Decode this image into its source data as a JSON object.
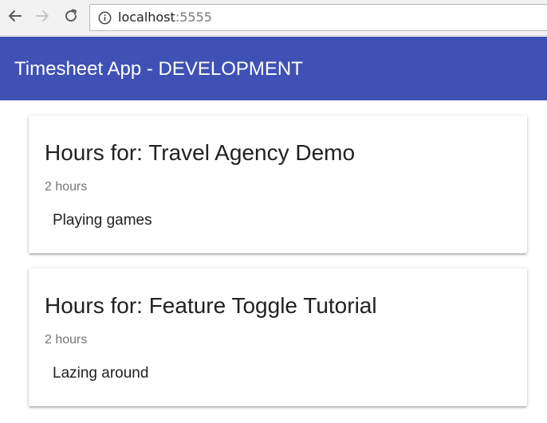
{
  "browser": {
    "url_host": "localhost",
    "url_port": ":5555",
    "icons": {
      "back": "back-arrow-icon",
      "forward": "forward-arrow-icon",
      "reload": "reload-icon",
      "info": "info-icon"
    }
  },
  "toolbar": {
    "title": "Timesheet App - DEVELOPMENT",
    "color": "#3f51b5"
  },
  "cards": [
    {
      "title": "Hours for: Travel Agency Demo",
      "subtitle": "2 hours",
      "content": "Playing games"
    },
    {
      "title": "Hours for: Feature Toggle Tutorial",
      "subtitle": "2 hours",
      "content": "Lazing around"
    }
  ]
}
